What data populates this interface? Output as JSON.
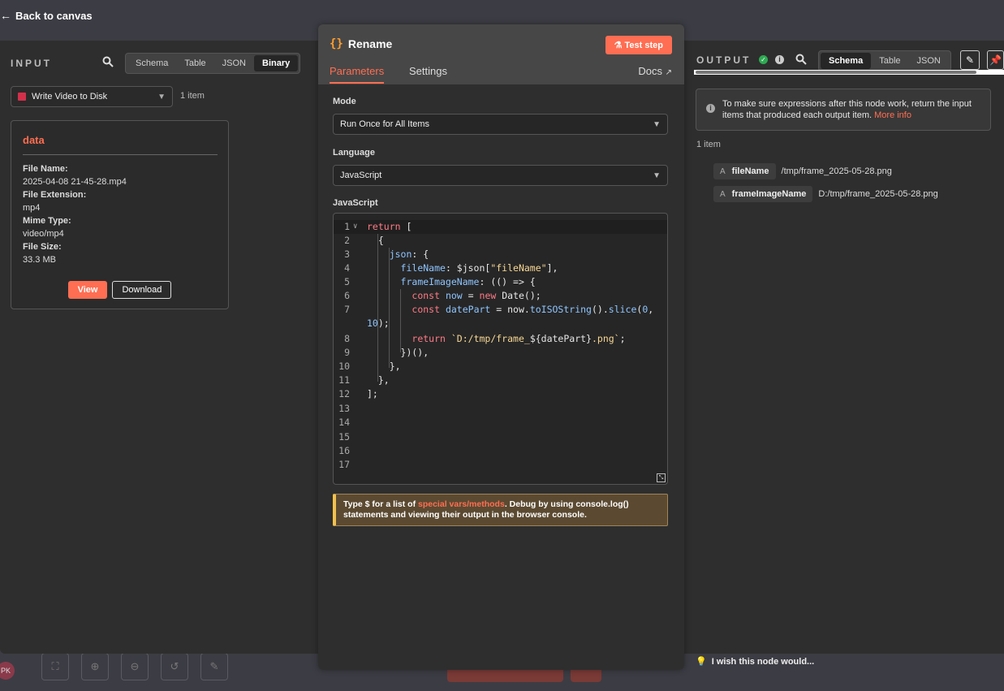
{
  "back": {
    "arrow": "←",
    "label": "Back to canvas"
  },
  "input": {
    "title": "INPUT",
    "views": [
      "Schema",
      "Table",
      "JSON",
      "Binary"
    ],
    "active_view": "Binary",
    "node_select": "Write Video to Disk",
    "item_count": "1 item",
    "card": {
      "title": "data",
      "fields": [
        {
          "key": "File Name:",
          "value": "2025-04-08 21-45-28.mp4"
        },
        {
          "key": "File Extension:",
          "value": "mp4"
        },
        {
          "key": "Mime Type:",
          "value": "video/mp4"
        },
        {
          "key": "File Size:",
          "value": "33.3 MB"
        }
      ],
      "view_label": "View",
      "download_label": "Download"
    }
  },
  "node": {
    "icon": "{}",
    "name": "Rename",
    "test_label": "Test step",
    "tabs": [
      "Parameters",
      "Settings"
    ],
    "docs_label": "Docs",
    "mode_label": "Mode",
    "mode_value": "Run Once for All Items",
    "language_label": "Language",
    "language_value": "JavaScript",
    "code_label": "JavaScript",
    "code_line_numbers": [
      "1",
      "2",
      "3",
      "4",
      "5",
      "6",
      "7",
      "",
      "8",
      "9",
      "10",
      "11",
      "12",
      "13",
      "14",
      "15",
      "16",
      "17"
    ],
    "hint": {
      "p1": "Type $ for a list of ",
      "link": "special vars/methods",
      "p2": ". Debug by using console.log() statements and viewing their output in the browser console."
    }
  },
  "output": {
    "title": "OUTPUT",
    "views": [
      "Schema",
      "Table",
      "JSON"
    ],
    "active_view": "Schema",
    "notice_text": "To make sure expressions after this node work, return the input items that produced each output item.",
    "notice_link": "More info",
    "item_count": "1 item",
    "fields": [
      {
        "type": "A",
        "name": "fileName",
        "value": "/tmp/frame_2025-05-28.png"
      },
      {
        "type": "A",
        "name": "frameImageName",
        "value": "D:/tmp/frame_2025-05-28.png"
      }
    ]
  },
  "feedback": "I wish this node would...",
  "avatar_initials": "PK"
}
